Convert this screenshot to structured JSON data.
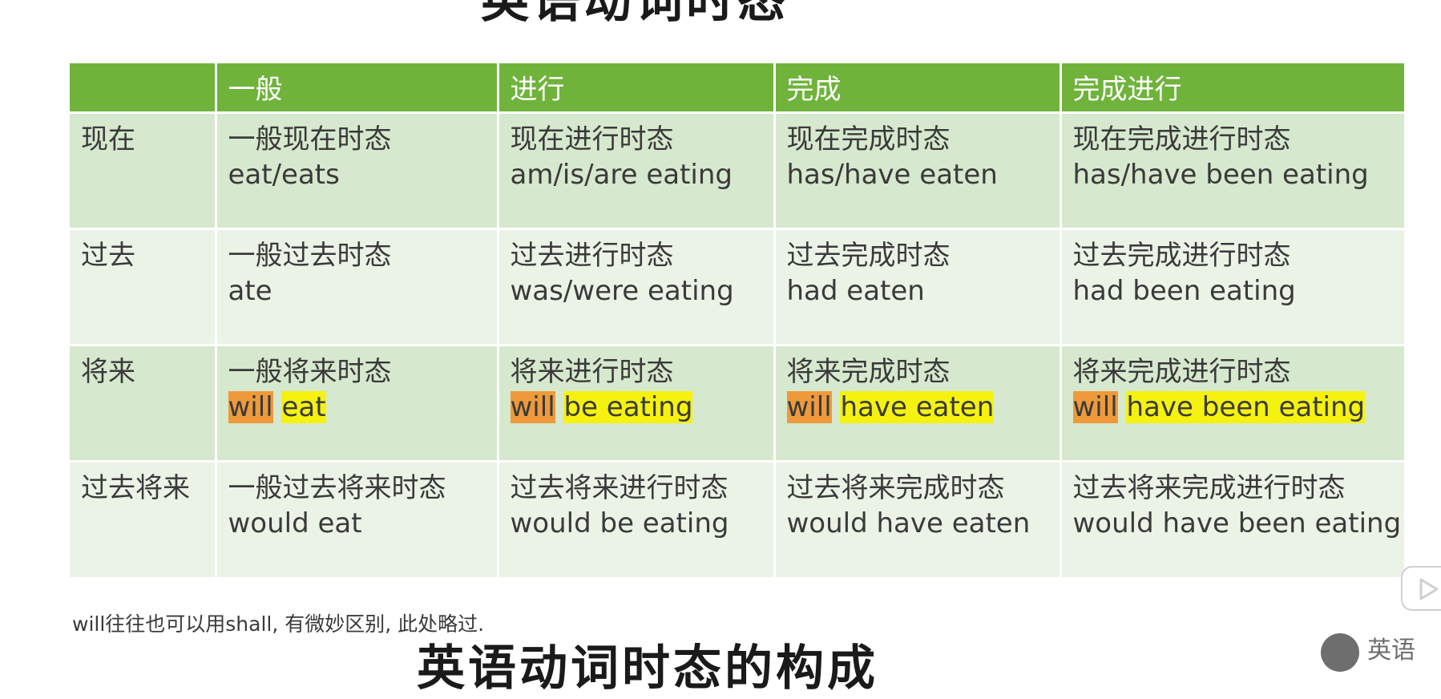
{
  "heading_top": "英语动词时态",
  "table": {
    "headers": [
      "",
      "一般",
      "进行",
      "完成",
      "完成进行"
    ],
    "rows": [
      {
        "label": "现在",
        "cells": [
          {
            "name": "一般现在时态",
            "form": "eat/eats"
          },
          {
            "name": "现在进行时态",
            "form": "am/is/are eating"
          },
          {
            "name": "现在完成时态",
            "form": "has/have eaten"
          },
          {
            "name": "现在完成进行时态",
            "form": "has/have been eating"
          }
        ]
      },
      {
        "label": "过去",
        "cells": [
          {
            "name": "一般过去时态",
            "form": "ate"
          },
          {
            "name": "过去进行时态",
            "form": "was/were eating"
          },
          {
            "name": "过去完成时态",
            "form": "had eaten"
          },
          {
            "name": "过去完成进行时态",
            "form": "had been eating"
          }
        ]
      },
      {
        "label": "将来",
        "cells": [
          {
            "name": "一般将来时态",
            "aux": "will",
            "main": "eat"
          },
          {
            "name": "将来进行时态",
            "aux": "will",
            "main": "be eating"
          },
          {
            "name": "将来完成时态",
            "aux": "will",
            "main": "have eaten"
          },
          {
            "name": "将来完成进行时态",
            "aux": "will",
            "main": "have been eating"
          }
        ]
      },
      {
        "label": "过去将来",
        "cells": [
          {
            "name": "一般过去将来时态",
            "form": "would eat"
          },
          {
            "name": "过去将来进行时态",
            "form": "would be eating"
          },
          {
            "name": "过去将来完成时态",
            "form": "would have eaten"
          },
          {
            "name": "过去将来完成进行时态",
            "form": "would have been eating"
          }
        ]
      }
    ]
  },
  "footnote": "will往往也可以用shall, 有微妙区别, 此处略过.",
  "heading_bottom": "英语动词时态的构成",
  "overlay": {
    "play_icon": "play-icon",
    "channel_name": "英语"
  },
  "colors": {
    "header_green": "#6fb33b",
    "row_dark": "#d6e8ce",
    "row_light": "#ebf3e7",
    "highlight_aux": "#ee9a3b",
    "highlight_main": "#f5f20f"
  }
}
